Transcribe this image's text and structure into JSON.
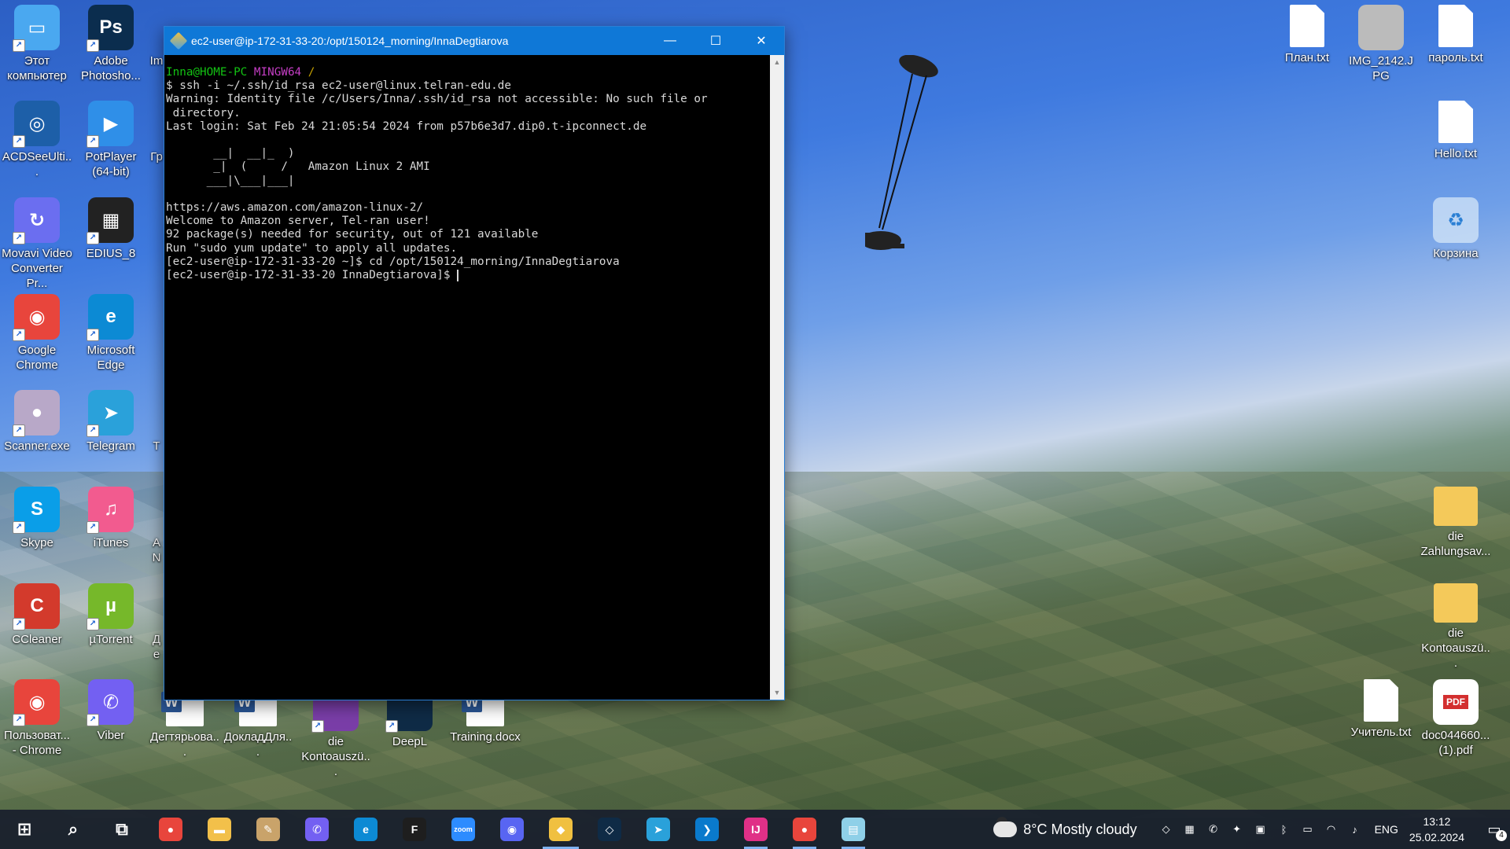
{
  "desktop": {
    "left_icons": [
      {
        "label": "Этот компьютер",
        "icon": "computer-icon",
        "color": "#4aa8f0"
      },
      {
        "label": "Adobe Photosho...",
        "icon": "photoshop-icon",
        "color": "#0b2d4e"
      },
      {
        "label": "Im",
        "icon": "partial-icon",
        "color": "#7da0c9"
      },
      {
        "label": "ACDSeeUlti...",
        "icon": "acdsee-icon",
        "color": "#1d5fa8"
      },
      {
        "label": "PotPlayer (64-bit)",
        "icon": "potplayer-icon",
        "color": "#2f8fe8"
      },
      {
        "label": "Гр",
        "icon": "partial-icon",
        "color": "#7da0c9"
      },
      {
        "label": "Movavi Video Converter Pr...",
        "icon": "movavi-icon",
        "color": "#6b6ef0"
      },
      {
        "label": "EDIUS_8",
        "icon": "edius-icon",
        "color": "#222222"
      },
      {
        "label": "Google Chrome",
        "icon": "chrome-icon",
        "color": "#e8453c"
      },
      {
        "label": "Microsoft Edge",
        "icon": "edge-icon",
        "color": "#0c8ad4"
      },
      {
        "label": "Scanner.exe",
        "icon": "scanner-icon",
        "color": "#b8a8c8"
      },
      {
        "label": "Telegram",
        "icon": "telegram-icon",
        "color": "#2aa1da"
      },
      {
        "label": "T",
        "icon": "partial-icon",
        "color": "#7da0c9"
      },
      {
        "label": "Skype",
        "icon": "skype-icon",
        "color": "#0a9ee8"
      },
      {
        "label": "iTunes",
        "icon": "itunes-icon",
        "color": "#f25b8f"
      },
      {
        "label": "A N",
        "icon": "partial-icon",
        "color": "#7da0c9"
      },
      {
        "label": "CCleaner",
        "icon": "ccleaner-icon",
        "color": "#d33a2c"
      },
      {
        "label": "µTorrent",
        "icon": "utorrent-icon",
        "color": "#76b82a"
      },
      {
        "label": "Де",
        "icon": "partial-icon",
        "color": "#7da0c9"
      },
      {
        "label": "Пользоват... - Chrome",
        "icon": "chrome-user-icon",
        "color": "#e8453c"
      },
      {
        "label": "Viber",
        "icon": "viber-icon",
        "color": "#7360f2"
      }
    ],
    "bottom_icons": [
      {
        "label": "Дегтярьова...",
        "icon": "word-doc-icon"
      },
      {
        "label": "ДокладДля...",
        "icon": "word-doc-icon"
      },
      {
        "label": "die Kontoauszü...",
        "icon": "winrar-icon"
      },
      {
        "label": "DeepL",
        "icon": "deepl-icon"
      },
      {
        "label": "Training.docx",
        "icon": "word-doc-icon"
      }
    ],
    "right_icons": [
      {
        "label": "План.txt",
        "icon": "text-file-icon"
      },
      {
        "label": "IMG_2142.JPG",
        "icon": "image-file-icon"
      },
      {
        "label": "пароль.txt",
        "icon": "text-file-icon"
      },
      {
        "label": "Hello.txt",
        "icon": "text-file-icon"
      },
      {
        "label": "Корзина",
        "icon": "recycle-bin-icon"
      },
      {
        "label": "die Zahlungsav...",
        "icon": "folder-icon"
      },
      {
        "label": "die Kontoauszü...",
        "icon": "folder-icon"
      },
      {
        "label": "Учитель.txt",
        "icon": "text-file-icon"
      },
      {
        "label": "doc044660... (1).pdf",
        "icon": "pdf-file-icon"
      }
    ]
  },
  "terminal": {
    "title": "ec2-user@ip-172-31-33-20:/opt/150124_morning/InnaDegtiarova",
    "prompt_user": "Inna@HOME-PC",
    "prompt_env": "MINGW64",
    "prompt_path": "/",
    "lines": [
      "$ ssh -i ~/.ssh/id_rsa ec2-user@linux.telran-edu.de",
      "Warning: Identity file /c/Users/Inna/.ssh/id_rsa not accessible: No such file or",
      " directory.",
      "Last login: Sat Feb 24 21:05:54 2024 from p57b6e3d7.dip0.t-ipconnect.de",
      "",
      "       __|  __|_  )",
      "       _|  (     /   Amazon Linux 2 AMI",
      "      ___|\\___|___|",
      "",
      "https://aws.amazon.com/amazon-linux-2/",
      "Welcome to Amazon server, Tel-ran user!",
      "92 package(s) needed for security, out of 121 available",
      "Run \"sudo yum update\" to apply all updates.",
      "[ec2-user@ip-172-31-33-20 ~]$ cd /opt/150124_morning/InnaDegtiarova",
      "[ec2-user@ip-172-31-33-20 InnaDegtiarova]$ "
    ],
    "controls": {
      "minimize": "—",
      "maximize": "☐",
      "close": "✕"
    }
  },
  "taskbar": {
    "apps": [
      {
        "name": "start",
        "glyph": "⊞",
        "color": "transparent"
      },
      {
        "name": "search",
        "glyph": "⌕",
        "color": "transparent"
      },
      {
        "name": "task-view",
        "glyph": "⧉",
        "color": "transparent"
      },
      {
        "name": "chrome",
        "glyph": "●",
        "color": "#e8453c"
      },
      {
        "name": "file-explorer",
        "glyph": "▬",
        "color": "#f2c04a"
      },
      {
        "name": "paint",
        "glyph": "✎",
        "color": "#c9a36a"
      },
      {
        "name": "viber",
        "glyph": "✆",
        "color": "#7360f2"
      },
      {
        "name": "edge",
        "glyph": "e",
        "color": "#0c8ad4"
      },
      {
        "name": "figma",
        "glyph": "F",
        "color": "#1e1e1e"
      },
      {
        "name": "zoom",
        "glyph": "zoom",
        "color": "#2d8cff"
      },
      {
        "name": "discord",
        "glyph": "◉",
        "color": "#5865f2"
      },
      {
        "name": "git-bash",
        "glyph": "◆",
        "color": "#f0c040"
      },
      {
        "name": "deepl",
        "glyph": "◇",
        "color": "#0f2b46"
      },
      {
        "name": "telegram",
        "glyph": "➤",
        "color": "#2aa1da"
      },
      {
        "name": "vscode",
        "glyph": "❯",
        "color": "#0a7acc"
      },
      {
        "name": "intellij",
        "glyph": "IJ",
        "color": "#e03087"
      },
      {
        "name": "chrome-profile",
        "glyph": "●",
        "color": "#e8453c"
      },
      {
        "name": "notepad",
        "glyph": "▤",
        "color": "#8fd0e8"
      }
    ],
    "weather": {
      "temp": "8°C",
      "condition": "Mostly cloudy"
    },
    "lang": "ENG",
    "time": "13:12",
    "date": "25.02.2024",
    "notification_count": "4"
  }
}
